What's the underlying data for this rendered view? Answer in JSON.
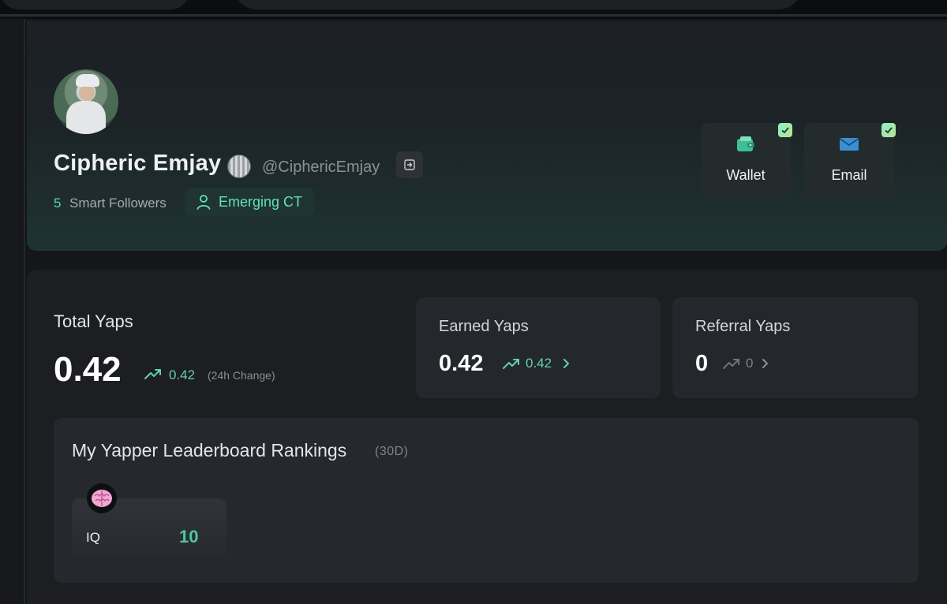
{
  "profile": {
    "name": "Cipheric Emjay",
    "handle": "@CiphericEmjay",
    "smart_followers_count": "5",
    "smart_followers_label": "Smart Followers",
    "tier": "Emerging CT",
    "verifications": [
      {
        "label": "Wallet",
        "verified": true,
        "icon": "wallet-icon"
      },
      {
        "label": "Email",
        "verified": true,
        "icon": "envelope-icon"
      }
    ]
  },
  "stats": {
    "total": {
      "title": "Total Yaps",
      "value": "0.42",
      "change": "0.42",
      "change_label": "(24h Change)"
    },
    "earned": {
      "title": "Earned Yaps",
      "value": "0.42",
      "change": "0.42"
    },
    "referral": {
      "title": "Referral Yaps",
      "value": "0",
      "change": "0"
    }
  },
  "leaderboard": {
    "title": "My Yapper Leaderboard Rankings",
    "period": "(30D)",
    "rankings": [
      {
        "label": "IQ",
        "value": "10",
        "icon": "brain-icon"
      }
    ]
  },
  "colors": {
    "accent_green": "#5fd3ad",
    "background": "#141619",
    "card": "#1c1e21"
  }
}
